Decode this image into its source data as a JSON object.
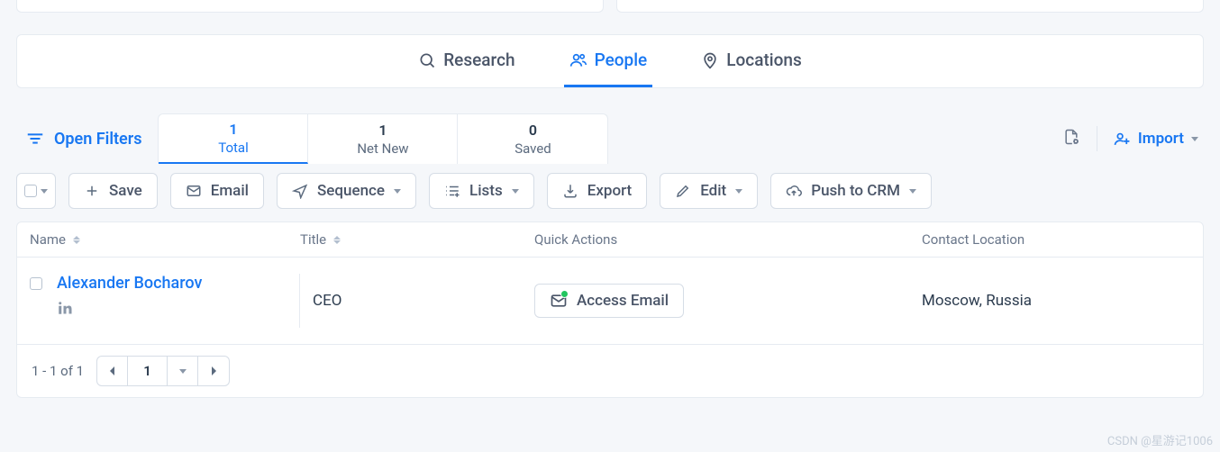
{
  "tabs": {
    "research": "Research",
    "people": "People",
    "locations": "Locations"
  },
  "filters": {
    "open": "Open Filters",
    "import": "Import"
  },
  "stats": [
    {
      "count": "1",
      "label": "Total",
      "active": true
    },
    {
      "count": "1",
      "label": "Net New",
      "active": false
    },
    {
      "count": "0",
      "label": "Saved",
      "active": false
    }
  ],
  "actions": {
    "save": "Save",
    "email": "Email",
    "sequence": "Sequence",
    "lists": "Lists",
    "export": "Export",
    "edit": "Edit",
    "push": "Push to CRM"
  },
  "columns": {
    "name": "Name",
    "title": "Title",
    "qa": "Quick Actions",
    "loc": "Contact Location"
  },
  "rows": [
    {
      "name": "Alexander Bocharov",
      "title": "CEO",
      "access": "Access Email",
      "location": "Moscow, Russia"
    }
  ],
  "pager": {
    "summary": "1 - 1 of 1",
    "page": "1"
  },
  "watermark": "CSDN @星游记1006"
}
